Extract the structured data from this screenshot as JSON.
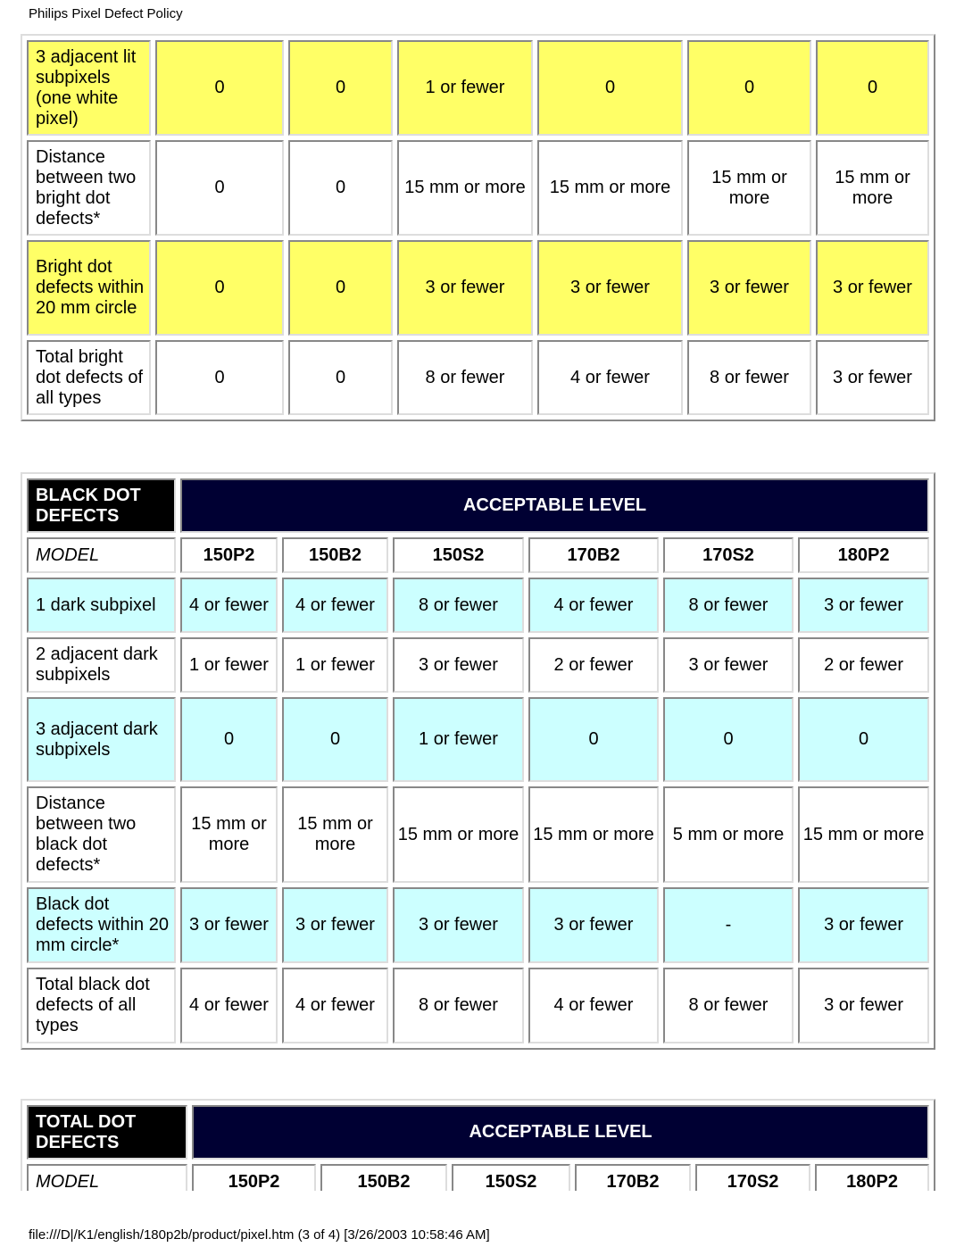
{
  "page_header": "Philips Pixel Defect Policy",
  "footer": "file:///D|/K1/english/180p2b/product/pixel.htm (3 of 4) [3/26/2003 10:58:46 AM]",
  "colors": {
    "bright_highlight": "#ffff66",
    "black_highlight": "#ccffff",
    "header_navy": "#000033",
    "header_black": "#000000"
  },
  "bright_table": {
    "rows": [
      {
        "label": "3 adjacent lit subpixels (one white pixel)",
        "values": [
          "0",
          "0",
          "1 or fewer",
          "0",
          "0",
          "0"
        ],
        "highlight": true
      },
      {
        "label": "Distance between two bright dot defects*",
        "values": [
          "0",
          "0",
          "15 mm or more",
          "15 mm or more",
          "15 mm or more",
          "15 mm or more"
        ],
        "highlight": false
      },
      {
        "label": "Bright dot defects within 20 mm circle",
        "values": [
          "0",
          "0",
          "3 or fewer",
          "3 or fewer",
          "3 or fewer",
          "3 or fewer"
        ],
        "highlight": true
      },
      {
        "label": "Total bright dot defects of all types",
        "values": [
          "0",
          "0",
          "8 or fewer",
          "4 or fewer",
          "8 or fewer",
          "3 or fewer"
        ],
        "highlight": false
      }
    ]
  },
  "black_table": {
    "title": "BLACK DOT DEFECTS",
    "level_header": "ACCEPTABLE LEVEL",
    "model_label": "MODEL",
    "models": [
      "150P2",
      "150B2",
      "150S2",
      "170B2",
      "170S2",
      "180P2"
    ],
    "rows": [
      {
        "label": "1 dark subpixel",
        "values": [
          "4 or fewer",
          "4 or fewer",
          "8 or fewer",
          "4 or fewer",
          "8 or fewer",
          "3 or fewer"
        ],
        "highlight": true
      },
      {
        "label": "2 adjacent dark subpixels",
        "values": [
          "1 or fewer",
          "1 or fewer",
          "3 or fewer",
          "2 or fewer",
          "3 or fewer",
          "2 or fewer"
        ],
        "highlight": false
      },
      {
        "label": "3 adjacent dark subpixels",
        "values": [
          "0",
          "0",
          "1 or fewer",
          "0",
          "0",
          "0"
        ],
        "highlight": true
      },
      {
        "label": "Distance between two black dot defects*",
        "values": [
          "15 mm or more",
          "15 mm or more",
          "15 mm or more",
          "15 mm or more",
          "5 mm or more",
          "15 mm or more"
        ],
        "highlight": false
      },
      {
        "label": "Black dot defects within 20 mm circle*",
        "values": [
          "3 or fewer",
          "3 or fewer",
          "3 or fewer",
          "3 or fewer",
          "-",
          "3 or fewer"
        ],
        "highlight": true
      },
      {
        "label": "Total black dot defects of all types",
        "values": [
          "4 or fewer",
          "4 or fewer",
          "8 or fewer",
          "4 or fewer",
          "8 or fewer",
          "3 or fewer"
        ],
        "highlight": false
      }
    ]
  },
  "total_table": {
    "title": "TOTAL DOT DEFECTS",
    "level_header": "ACCEPTABLE LEVEL",
    "model_label": "MODEL",
    "models": [
      "150P2",
      "150B2",
      "150S2",
      "170B2",
      "170S2",
      "180P2"
    ]
  }
}
